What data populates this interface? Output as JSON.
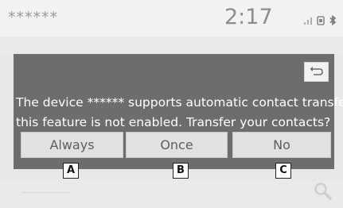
{
  "status_bar": {
    "device_name": "******",
    "clock": "2:17",
    "icons": [
      "signal-icon",
      "phone-icon",
      "bluetooth-icon"
    ]
  },
  "dialog": {
    "message_line1": "The device ****** supports automatic contact transfer, but",
    "message_line2": "this feature is not enabled. Transfer your contacts?",
    "back_icon": "return-arrow-icon",
    "buttons": {
      "always": "Always",
      "once": "Once",
      "no": "No"
    }
  },
  "callouts": [
    "A",
    "B",
    "C"
  ],
  "background": {
    "search_icon": "search-icon"
  },
  "colors": {
    "dialog_bg": "#6c6d6d",
    "button_bg": "#e1e1e1",
    "screen_bg": "#e7e8e8"
  }
}
